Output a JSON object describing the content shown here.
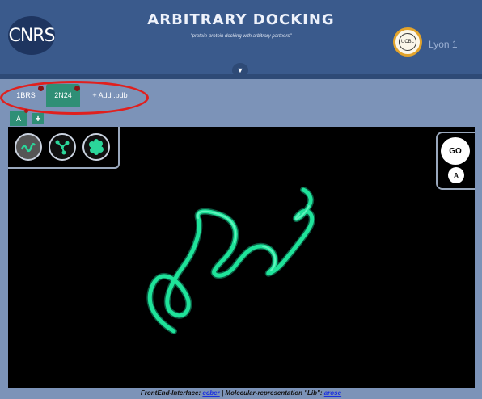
{
  "header": {
    "title": "ARBITRARY DOCKING",
    "subtitle": "\"protein-protein docking with arbitrary partners\"",
    "left_logo_text": "CNRS",
    "right_logo_text": "Lyon 1",
    "right_logo_badge": "UCBL"
  },
  "tabs": [
    {
      "label": "1BRS",
      "active": false
    },
    {
      "label": "2N24",
      "active": true
    },
    {
      "label": "+ Add .pdb",
      "active": false
    }
  ],
  "chain_bar": {
    "chain_label": "A",
    "add_label": "+"
  },
  "representation_buttons": [
    {
      "icon": "cartoon-icon",
      "active": true
    },
    {
      "icon": "trace-icon",
      "active": false
    },
    {
      "icon": "surface-icon",
      "active": false
    }
  ],
  "controls": {
    "go_label": "GO",
    "chain_label": "A"
  },
  "footer": {
    "prefix": "FrontEnd-Interface:",
    "frontend_link": "ceber",
    "separator": "| Molecular-representation \"Lib\":",
    "lib_link": "arose"
  },
  "colors": {
    "header": "#3a5a8c",
    "accent": "#2f8f76",
    "protein": "#1fe39a",
    "highlight": "#e0201e"
  }
}
